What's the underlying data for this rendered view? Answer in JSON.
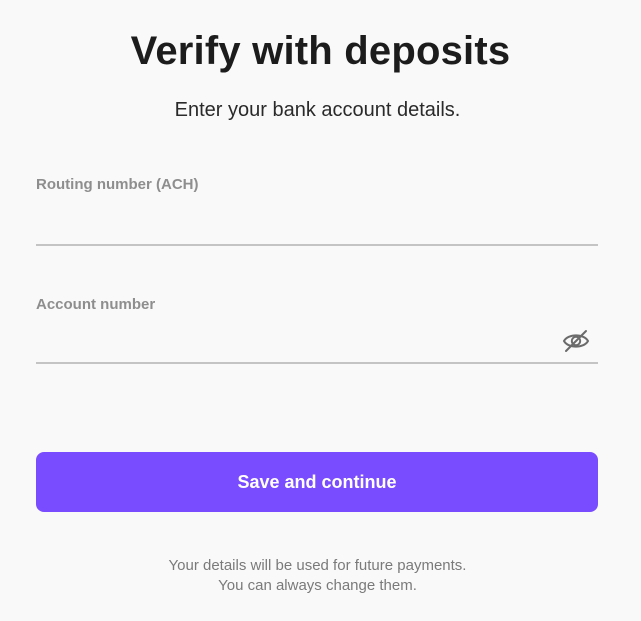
{
  "header": {
    "title": "Verify with deposits",
    "subtitle": "Enter your bank account details."
  },
  "form": {
    "routing": {
      "label": "Routing number (ACH)",
      "value": ""
    },
    "account": {
      "label": "Account number",
      "value": "",
      "toggle_icon": "eye-slash-icon"
    },
    "submit_label": "Save and continue"
  },
  "footer": {
    "line1": "Your details will be used for future payments.",
    "line2": "You can always change them."
  },
  "colors": {
    "accent": "#7a4cff",
    "background": "#f9f9f9",
    "label": "#8e8e8e",
    "underline": "#c4c4c4"
  }
}
